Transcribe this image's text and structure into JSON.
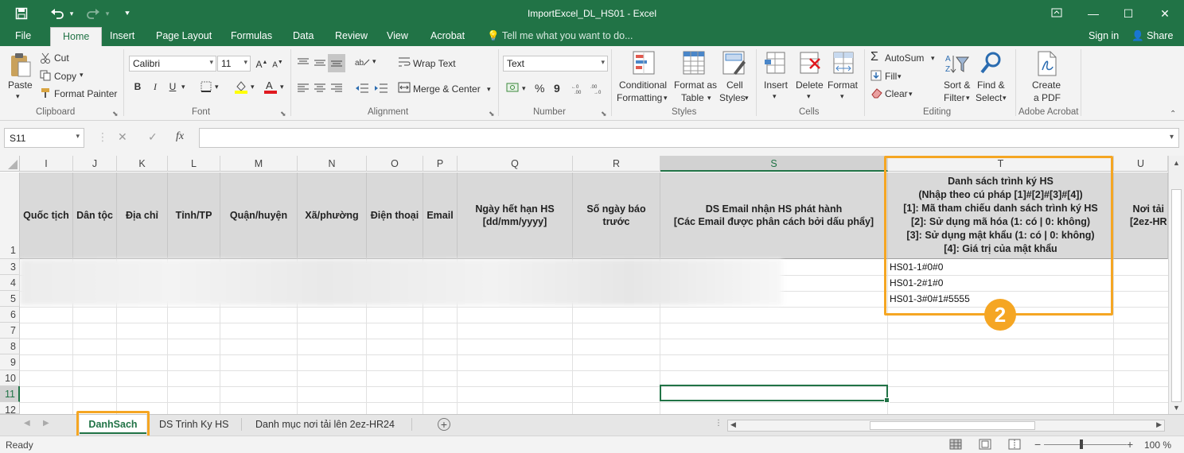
{
  "window": {
    "title": "ImportExcel_DL_HS01 - Excel",
    "save_icon": "save-icon",
    "undo_icon": "undo-icon",
    "redo_icon": "redo-icon"
  },
  "menu": {
    "tabs": [
      "File",
      "Home",
      "Insert",
      "Page Layout",
      "Formulas",
      "Data",
      "Review",
      "View",
      "Acrobat"
    ],
    "active_tab": "Home",
    "tell_me": "Tell me what you want to do...",
    "sign_in": "Sign in",
    "share": "Share"
  },
  "ribbon": {
    "clipboard": {
      "label": "Clipboard",
      "paste": "Paste",
      "cut": "Cut",
      "copy": "Copy",
      "format_painter": "Format Painter"
    },
    "font": {
      "label": "Font",
      "name": "Calibri",
      "size": "11",
      "bold": "B",
      "italic": "I",
      "underline": "U"
    },
    "alignment": {
      "label": "Alignment",
      "wrap_text": "Wrap Text",
      "merge_center": "Merge & Center"
    },
    "number": {
      "label": "Number",
      "format": "Text",
      "percent": "%",
      "comma": "9"
    },
    "styles": {
      "label": "Styles",
      "conditional_line1": "Conditional",
      "conditional_line2": "Formatting",
      "format_table_line1": "Format as",
      "format_table_line2": "Table",
      "cell_styles_line1": "Cell",
      "cell_styles_line2": "Styles"
    },
    "cells": {
      "label": "Cells",
      "insert": "Insert",
      "delete": "Delete",
      "format": "Format"
    },
    "editing": {
      "label": "Editing",
      "autosum": "AutoSum",
      "fill": "Fill",
      "clear": "Clear",
      "sort_filter_line1": "Sort &",
      "sort_filter_line2": "Filter",
      "find_select_line1": "Find &",
      "find_select_line2": "Select"
    },
    "acrobat": {
      "label": "Adobe Acrobat",
      "create_line1": "Create",
      "create_line2": "a PDF"
    }
  },
  "formula_bar": {
    "name_box": "S11",
    "fx": "fx",
    "cancel": "✕",
    "enter": "✓",
    "value": ""
  },
  "columns": [
    "I",
    "J",
    "K",
    "L",
    "M",
    "N",
    "O",
    "P",
    "Q",
    "R",
    "S",
    "T",
    "U"
  ],
  "selected_column": "S",
  "rows": [
    "1",
    "3",
    "4",
    "5",
    "6",
    "7",
    "8",
    "9",
    "10",
    "11",
    "12"
  ],
  "selected_row": "11",
  "headers": {
    "I": "Quốc tịch",
    "J": "Dân tộc",
    "K": "Địa chỉ",
    "L": "Tỉnh/TP",
    "M": "Quận/huyện",
    "N": "Xã/phường",
    "O": "Điện thoại",
    "P": "Email",
    "Q": [
      "Ngày hết hạn HS",
      "[dd/mm/yyyy]"
    ],
    "R": [
      "Số ngày báo",
      "trước"
    ],
    "S": [
      "DS Email nhận HS phát hành",
      "[Các Email được phân cách bởi dấu phẩy]"
    ],
    "T": [
      "Danh sách trình ký HS",
      "(Nhập theo cú pháp [1]#[2]#[3]#[4])",
      "[1]: Mã tham chiếu danh sách trình ký HS",
      "[2]: Sử dụng mã hóa (1: có | 0: không)",
      "[3]: Sử dụng mật khẩu (1: có | 0: không)",
      "[4]: Giá trị của mật khẩu"
    ],
    "U": [
      "Nơi tải",
      "[2ez-HR"
    ]
  },
  "cells": {
    "T3": "HS01-1#0#0",
    "T4": "HS01-2#1#0",
    "T5": "HS01-3#0#1#5555"
  },
  "callout": {
    "number": "2",
    "color": "#f5a623"
  },
  "sheets": [
    "DanhSach",
    "DS Trinh Ky HS",
    "Danh mục nơi tải lên 2ez-HR24"
  ],
  "active_sheet": "DanhSach",
  "status": {
    "ready": "Ready",
    "zoom": "100 %"
  },
  "colors": {
    "excel_green": "#217346",
    "highlight": "#f5a623",
    "header_fill": "#d9d9d9"
  }
}
